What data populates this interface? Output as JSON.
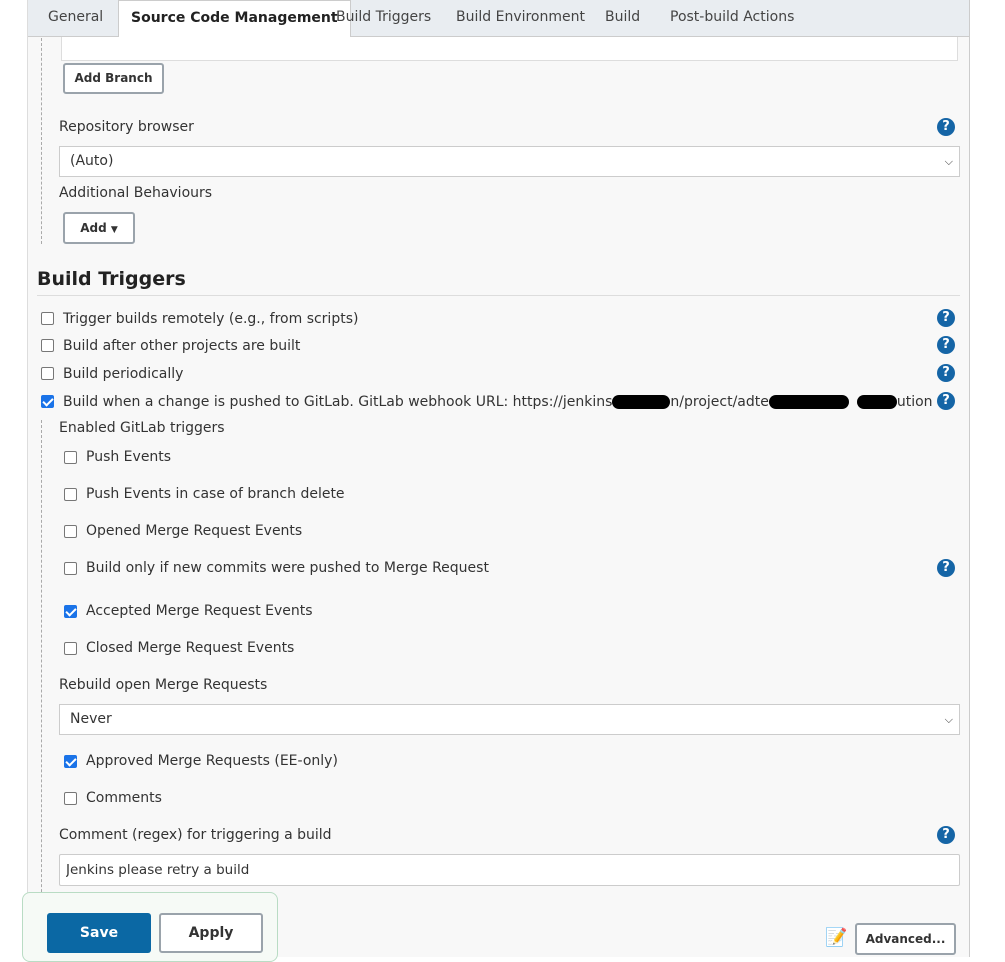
{
  "tabs": [
    "General",
    "Source Code Management",
    "Build Triggers",
    "Build Environment",
    "Build",
    "Post-build Actions"
  ],
  "active_tab": "Source Code Management",
  "scm": {
    "add_branch": "Add Branch",
    "repo_browser_label": "Repository browser",
    "repo_browser_value": "(Auto)",
    "additional_behaviours": "Additional Behaviours",
    "add_label": "Add"
  },
  "build_triggers": {
    "title": "Build Triggers",
    "options": [
      {
        "label": "Trigger builds remotely (e.g., from scripts)",
        "checked": false
      },
      {
        "label": "Build after other projects are built",
        "checked": false
      },
      {
        "label": "Build periodically",
        "checked": false
      }
    ],
    "gitlab": {
      "prefix": "Build when a change is pushed to GitLab. GitLab webhook URL: https://jenkins",
      "part2": "n/project/adte",
      "part3": "ution",
      "checked": true
    },
    "enabled_label": "Enabled GitLab triggers",
    "events": [
      {
        "label": "Push Events",
        "checked": false
      },
      {
        "label": "Push Events in case of branch delete",
        "checked": false
      },
      {
        "label": "Opened Merge Request Events",
        "checked": false
      },
      {
        "label": "Build only if new commits were pushed to Merge Request",
        "checked": false
      },
      {
        "label": "Accepted Merge Request Events",
        "checked": true
      },
      {
        "label": "Closed Merge Request Events",
        "checked": false
      }
    ],
    "rebuild_label": "Rebuild open Merge Requests",
    "rebuild_value": "Never",
    "approved": {
      "label": "Approved Merge Requests (EE-only)",
      "checked": true
    },
    "comments": {
      "label": "Comments",
      "checked": false
    },
    "comment_regex_label": "Comment (regex) for triggering a build",
    "comment_regex_value": "Jenkins please retry a build"
  },
  "footer": {
    "save": "Save",
    "apply": "Apply",
    "advanced": "Advanced..."
  },
  "colors": {
    "primary": "#0b68a4",
    "help": "#1565a6",
    "checkbox": "#1a73e8"
  }
}
